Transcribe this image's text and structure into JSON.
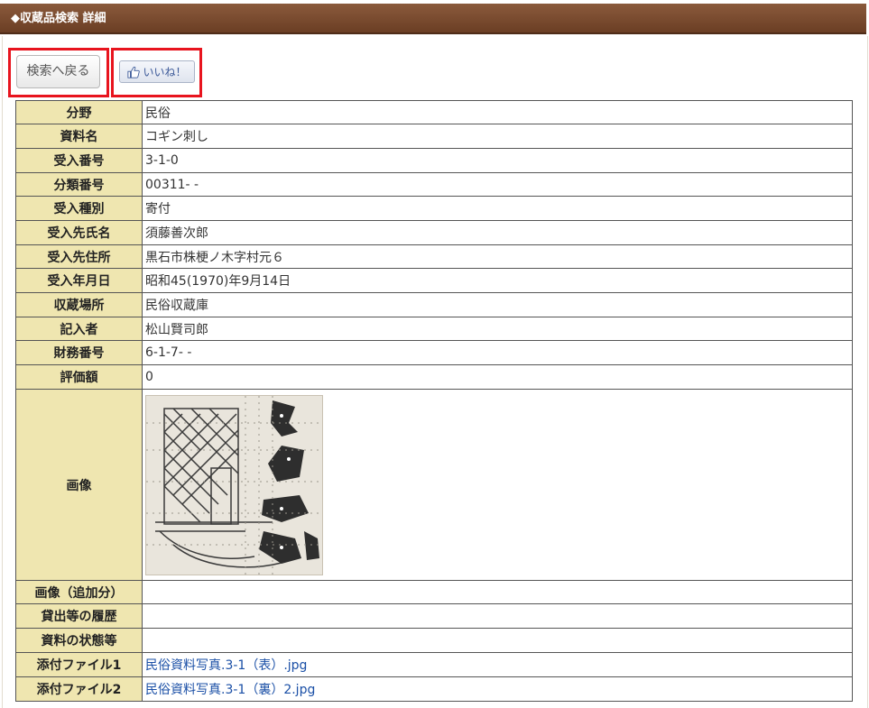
{
  "header": {
    "title": "◆収蔵品検索 詳細"
  },
  "buttons": {
    "back_label": "検索へ戻る",
    "like_label": "いいね！"
  },
  "rows": [
    {
      "label": "分野",
      "value": "民俗"
    },
    {
      "label": "資料名",
      "value": "コギン刺し"
    },
    {
      "label": "受入番号",
      "value": "3-1-0"
    },
    {
      "label": "分類番号",
      "value": "00311- -"
    },
    {
      "label": "受入種別",
      "value": "寄付"
    },
    {
      "label": "受入先氏名",
      "value": "須藤善次郎"
    },
    {
      "label": "受入先住所",
      "value": "黒石市株梗ノ木字村元６"
    },
    {
      "label": "受入年月日",
      "value": "昭和45(1970)年9月14日"
    },
    {
      "label": "収蔵場所",
      "value": "民俗収蔵庫"
    },
    {
      "label": "記入者",
      "value": "松山賢司郎"
    },
    {
      "label": "財務番号",
      "value": "6-1-7- -"
    },
    {
      "label": "評価額",
      "value": "0"
    }
  ],
  "image_row": {
    "label": "画像"
  },
  "extra_rows": [
    {
      "label": "画像（追加分）",
      "value": ""
    },
    {
      "label": "貸出等の履歴",
      "value": ""
    },
    {
      "label": "資料の状態等",
      "value": ""
    }
  ],
  "attachments": [
    {
      "label": "添付ファイル1",
      "value": "民俗資料写真.3-1（表）.jpg"
    },
    {
      "label": "添付ファイル2",
      "value": "民俗資料写真.3-1（裏）2.jpg"
    }
  ],
  "colors": {
    "header_bg": "#7a4a2e",
    "label_bg": "#efe6b0",
    "highlight_border": "#e8141e",
    "link": "#1a4fa6"
  }
}
